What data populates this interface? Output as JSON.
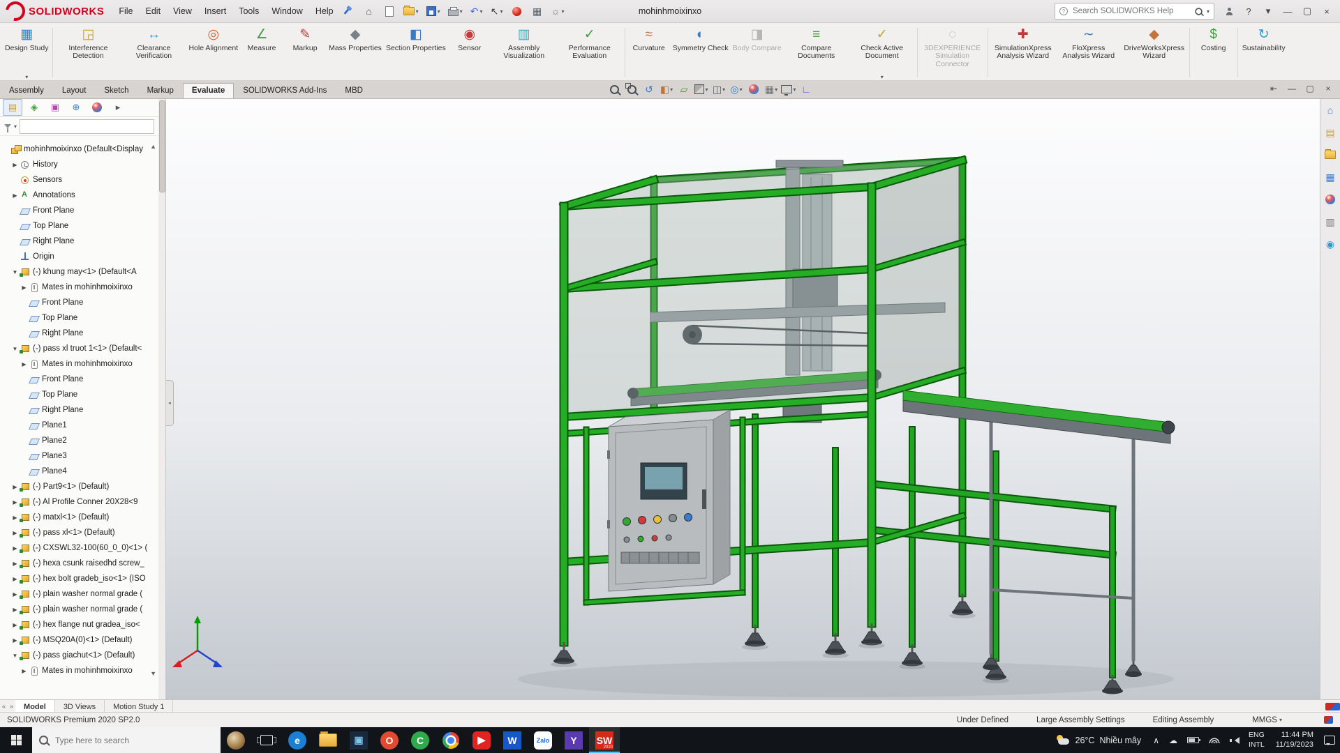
{
  "titlebar": {
    "brand": "SOLIDWORKS",
    "menus": [
      "File",
      "Edit",
      "View",
      "Insert",
      "Tools",
      "Window",
      "Help"
    ],
    "quick_tools": [
      {
        "name": "home-button",
        "glyph": "⌂",
        "color": "#4a5056"
      },
      {
        "name": "new-document-button",
        "kind": "doc"
      },
      {
        "name": "open-document-button",
        "kind": "folder",
        "arrow": true
      },
      {
        "name": "save-button",
        "kind": "save",
        "arrow": true
      },
      {
        "name": "print-button",
        "kind": "printer",
        "arrow": true
      },
      {
        "name": "undo-button",
        "glyph": "↶",
        "color": "#3a6fd1",
        "arrow": true
      },
      {
        "name": "select-tool-button",
        "glyph": "↖",
        "color": "#3c4044",
        "arrow": true
      },
      {
        "name": "edit-appearance-quick-button",
        "kind": "ball-red"
      },
      {
        "name": "display-grid-button",
        "glyph": "▦",
        "color": "#5a6066"
      },
      {
        "name": "options-button",
        "glyph": "☼",
        "color": "#6a7076",
        "arrow": true
      }
    ],
    "document_title": "mohinhmoixinxo",
    "search_placeholder": "Search SOLIDWORKS Help",
    "window_controls": [
      {
        "name": "user-account-icon",
        "kind": "user"
      },
      {
        "name": "help-button",
        "glyph": "?"
      },
      {
        "name": "help-dropdown-icon",
        "glyph": "▾"
      },
      {
        "name": "window-minimize-button",
        "glyph": "—"
      },
      {
        "name": "window-maximize-button",
        "glyph": "▢"
      },
      {
        "name": "window-close-button",
        "glyph": "×"
      }
    ]
  },
  "ribbon": {
    "groups": [
      [
        {
          "label": "Design Study",
          "glyph": "▦",
          "color": "#2e7dd1",
          "arrow": true
        }
      ],
      [
        {
          "label": "Interference Detection",
          "glyph": "◲",
          "color": "#d1a12e"
        },
        {
          "label": "Clearance Verification",
          "glyph": "↔",
          "color": "#2e9bd1"
        },
        {
          "label": "Hole Alignment",
          "glyph": "◎",
          "color": "#d1662e"
        },
        {
          "label": "Measure",
          "glyph": "∠",
          "color": "#3aa13a"
        },
        {
          "label": "Markup",
          "glyph": "✎",
          "color": "#c23a3a"
        },
        {
          "label": "Mass Properties",
          "glyph": "◆",
          "color": "#7a8289"
        },
        {
          "label": "Section Properties",
          "glyph": "◧",
          "color": "#3a7ac2"
        },
        {
          "label": "Sensor",
          "glyph": "◉",
          "color": "#c23a3a"
        },
        {
          "label": "Assembly Visualization",
          "glyph": "▥",
          "color": "#3ab0c2"
        },
        {
          "label": "Performance Evaluation",
          "glyph": "✓",
          "color": "#3aa13a"
        }
      ],
      [
        {
          "label": "Curvature",
          "glyph": "≈",
          "color": "#c2743a"
        },
        {
          "label": "Symmetry Check",
          "glyph": "◐",
          "color": "#3a7ac2"
        },
        {
          "label": "Body Compare",
          "glyph": "◨",
          "color": "#9aa0a6",
          "disabled": true
        },
        {
          "label": "Compare Documents",
          "glyph": "≡",
          "color": "#3aa13a"
        },
        {
          "label": "Check Active Document",
          "glyph": "✓",
          "color": "#c2a23a",
          "arrow": true
        }
      ],
      [
        {
          "label": "3DEXPERIENCE Simulation Connector",
          "glyph": "◌",
          "color": "#9aa0a6",
          "disabled": true
        }
      ],
      [
        {
          "label": "SimulationXpress Analysis Wizard",
          "glyph": "✚",
          "color": "#c23a3a"
        },
        {
          "label": "FloXpress Analysis Wizard",
          "glyph": "∼",
          "color": "#3a7ac2"
        },
        {
          "label": "DriveWorksXpress Wizard",
          "glyph": "◆",
          "color": "#c2743a"
        }
      ],
      [
        {
          "label": "Costing",
          "glyph": "$",
          "color": "#3aa13a"
        }
      ],
      [
        {
          "label": "Sustainability",
          "glyph": "↻",
          "color": "#2e9bd1"
        }
      ]
    ]
  },
  "tabs": {
    "items": [
      "Assembly",
      "Layout",
      "Sketch",
      "Markup",
      "Evaluate",
      "SOLIDWORKS Add-Ins",
      "MBD"
    ],
    "active_index": 4
  },
  "headsup": [
    {
      "name": "zoom-to-fit-button",
      "kind": "magnifier"
    },
    {
      "name": "zoom-to-area-button",
      "kind": "magnifier-area"
    },
    {
      "name": "previous-view-button",
      "glyph": "↺",
      "color": "#3a6fd1"
    },
    {
      "name": "section-view-button",
      "glyph": "◧",
      "color": "#c2743a",
      "arrow": true
    },
    {
      "name": "dynamic-annotation-button",
      "glyph": "▱",
      "color": "#3aa13a"
    },
    {
      "name": "view-orientation-button",
      "kind": "cube",
      "arrow": true
    },
    {
      "name": "display-style-button",
      "glyph": "◫",
      "color": "#5a6066",
      "arrow": true
    },
    {
      "name": "hide-show-items-button",
      "glyph": "◎",
      "color": "#3a7ad1",
      "arrow": true
    },
    {
      "name": "edit-appearance-button",
      "kind": "ball"
    },
    {
      "name": "apply-scene-button",
      "glyph": "▦",
      "color": "#6a7076",
      "arrow": true
    },
    {
      "name": "view-settings-button",
      "kind": "monitor",
      "arrow": true
    },
    {
      "name": "orientation-axes-button",
      "glyph": "∟",
      "color": "#3a6fd1"
    }
  ],
  "doc_controls": [
    {
      "name": "doc-dock-button",
      "glyph": "⇤"
    },
    {
      "name": "doc-minimize-button",
      "glyph": "—"
    },
    {
      "name": "doc-restore-button",
      "glyph": "▢"
    },
    {
      "name": "doc-close-button",
      "glyph": "×"
    }
  ],
  "left_panel": {
    "tabs": [
      {
        "name": "featuremanager-tab",
        "glyph": "▤",
        "color": "#caa23a"
      },
      {
        "name": "propertymanager-tab",
        "glyph": "◈",
        "color": "#3aa13a"
      },
      {
        "name": "configurationmanager-tab",
        "glyph": "▣",
        "color": "#b04ab0"
      },
      {
        "name": "dimxpertmanager-tab",
        "glyph": "⊕",
        "color": "#3a7ad1"
      },
      {
        "name": "displaymanager-tab",
        "kind": "ball"
      },
      {
        "name": "panel-tabs-expand",
        "glyph": "▸",
        "color": "#555555"
      }
    ],
    "tree": [
      {
        "label": "mohinhmoixinxo (Default<Display",
        "icon": "assembly",
        "level": 0,
        "arrow": null
      },
      {
        "label": "History",
        "icon": "history",
        "level": 1,
        "arrow": "r"
      },
      {
        "label": "Sensors",
        "icon": "sensors",
        "level": 1,
        "arrow": null
      },
      {
        "label": "Annotations",
        "icon": "annotations",
        "level": 1,
        "arrow": "r"
      },
      {
        "label": "Front Plane",
        "icon": "plane",
        "level": 1,
        "arrow": null
      },
      {
        "label": "Top Plane",
        "icon": "plane",
        "level": 1,
        "arrow": null
      },
      {
        "label": "Right Plane",
        "icon": "plane",
        "level": 1,
        "arrow": null
      },
      {
        "label": "Origin",
        "icon": "origin",
        "level": 1,
        "arrow": null
      },
      {
        "label": "(-) khung may<1> (Default<A",
        "icon": "component",
        "level": 1,
        "arrow": "d"
      },
      {
        "label": "Mates in mohinhmoixinxo",
        "icon": "mates",
        "level": 2,
        "arrow": "r"
      },
      {
        "label": "Front Plane",
        "icon": "plane",
        "level": 2,
        "arrow": null
      },
      {
        "label": "Top Plane",
        "icon": "plane",
        "level": 2,
        "arrow": null
      },
      {
        "label": "Right Plane",
        "icon": "plane",
        "level": 2,
        "arrow": null
      },
      {
        "label": "(-) pass xl truot 1<1> (Default<",
        "icon": "component",
        "level": 1,
        "arrow": "d"
      },
      {
        "label": "Mates in mohinhmoixinxo",
        "icon": "mates",
        "level": 2,
        "arrow": "r"
      },
      {
        "label": "Front Plane",
        "icon": "plane",
        "level": 2,
        "arrow": null
      },
      {
        "label": "Top Plane",
        "icon": "plane",
        "level": 2,
        "arrow": null
      },
      {
        "label": "Right Plane",
        "icon": "plane",
        "level": 2,
        "arrow": null
      },
      {
        "label": "Plane1",
        "icon": "plane",
        "level": 2,
        "arrow": null
      },
      {
        "label": "Plane2",
        "icon": "plane",
        "level": 2,
        "arrow": null
      },
      {
        "label": "Plane3",
        "icon": "plane",
        "level": 2,
        "arrow": null
      },
      {
        "label": "Plane4",
        "icon": "plane",
        "level": 2,
        "arrow": null
      },
      {
        "label": "(-) Part9<1> (Default)",
        "icon": "component",
        "level": 1,
        "arrow": "r"
      },
      {
        "label": "(-) Al Profile Conner 20X28<9",
        "icon": "component",
        "level": 1,
        "arrow": "r"
      },
      {
        "label": "(-) matxl<1> (Default)",
        "icon": "component",
        "level": 1,
        "arrow": "r"
      },
      {
        "label": "(-) pass xl<1> (Default)",
        "icon": "component",
        "level": 1,
        "arrow": "r"
      },
      {
        "label": "(-) CXSWL32-100(60_0_0)<1> (",
        "icon": "component",
        "level": 1,
        "arrow": "r"
      },
      {
        "label": "(-) hexa csunk raisedhd screw_",
        "icon": "component",
        "level": 1,
        "arrow": "r"
      },
      {
        "label": "(-) hex bolt gradeb_iso<1> (ISO",
        "icon": "component",
        "level": 1,
        "arrow": "r"
      },
      {
        "label": "(-) plain washer normal grade (",
        "icon": "component",
        "level": 1,
        "arrow": "r"
      },
      {
        "label": "(-) plain washer normal grade (",
        "icon": "component",
        "level": 1,
        "arrow": "r"
      },
      {
        "label": "(-) hex flange nut gradea_iso<",
        "icon": "component",
        "level": 1,
        "arrow": "r"
      },
      {
        "label": "(-) MSQ20A(0)<1> (Default)",
        "icon": "component",
        "level": 1,
        "arrow": "r"
      },
      {
        "label": "(-) pass giachut<1> (Default)",
        "icon": "component",
        "level": 1,
        "arrow": "d"
      },
      {
        "label": "Mates in mohinhmoixinxo",
        "icon": "mates",
        "level": 2,
        "arrow": "r"
      }
    ]
  },
  "taskpane": [
    {
      "name": "solidworks-resources-tab",
      "glyph": "⌂",
      "color": "#3a7ad1"
    },
    {
      "name": "design-library-tab",
      "glyph": "▤",
      "color": "#caa23a"
    },
    {
      "name": "file-explorer-tab",
      "kind": "folder"
    },
    {
      "name": "view-palette-tab",
      "glyph": "▦",
      "color": "#3a7ad1"
    },
    {
      "name": "appearances-scenes-tab",
      "kind": "ball"
    },
    {
      "name": "custom-properties-tab",
      "glyph": "▥",
      "color": "#777777"
    },
    {
      "name": "solidworks-forum-tab",
      "glyph": "◉",
      "color": "#2e9bd1"
    }
  ],
  "bottom_tabs": {
    "scroll_icons": [
      "«",
      "»"
    ],
    "items": [
      "Model",
      "3D Views",
      "Motion Study 1"
    ],
    "active_index": 0
  },
  "status": {
    "left": "SOLIDWORKS Premium 2020 SP2.0",
    "items": [
      "Under Defined",
      "Large Assembly Settings",
      "Editing Assembly"
    ],
    "units": "MMGS"
  },
  "taskbar": {
    "search_placeholder": "Type here to search",
    "apps": [
      {
        "name": "pinned-dog-app",
        "kind": "dog"
      },
      {
        "name": "task-view",
        "kind": "taskview"
      },
      {
        "name": "edge-browser",
        "glyph": "e",
        "bg": "#1b7fd4",
        "fg": "#ffffff",
        "shape": "circle"
      },
      {
        "name": "file-explorer",
        "kind": "folder-lg"
      },
      {
        "name": "microsoft-store",
        "glyph": "▣",
        "bg": "#17283f",
        "fg": "#7ec3e8",
        "shape": "square"
      },
      {
        "name": "browser-red",
        "glyph": "O",
        "bg": "#e04a2f",
        "fg": "#ffffff",
        "shape": "circle"
      },
      {
        "name": "coccoc-browser",
        "glyph": "C",
        "bg": "#2faa4a",
        "fg": "#ffffff",
        "shape": "circle"
      },
      {
        "name": "chrome-browser",
        "kind": "chrome"
      },
      {
        "name": "youtube",
        "glyph": "▶",
        "bg": "#e02424",
        "fg": "#ffffff",
        "shape": "rounded"
      },
      {
        "name": "word",
        "glyph": "W",
        "bg": "#1857c8",
        "fg": "#ffffff",
        "shape": "square"
      },
      {
        "name": "zalo",
        "glyph": "Zalo",
        "bg": "#ffffff",
        "fg": "#1b6fe8",
        "shape": "rounded",
        "small": true
      },
      {
        "name": "mail-app",
        "glyph": "Y",
        "bg": "#5a3ab0",
        "fg": "#ffffff",
        "shape": "square"
      },
      {
        "name": "solidworks-2020",
        "glyph": "SW",
        "sub": "2020",
        "bg": "#d42a1e",
        "fg": "#ffffff",
        "shape": "square",
        "active": true
      }
    ],
    "weather": {
      "temp": "26°C",
      "desc": "Nhiều mây"
    },
    "tray": [
      {
        "name": "hidden-icons-button",
        "glyph": "∧"
      },
      {
        "name": "onedrive-icon",
        "glyph": "☁"
      },
      {
        "name": "battery-icon",
        "kind": "battery"
      },
      {
        "name": "network-icon",
        "kind": "wifi"
      },
      {
        "name": "volume-icon",
        "kind": "volume"
      }
    ],
    "lang": [
      "ENG",
      "INTL"
    ],
    "clock": {
      "time": "11:44 PM",
      "date": "11/19/2023"
    }
  }
}
